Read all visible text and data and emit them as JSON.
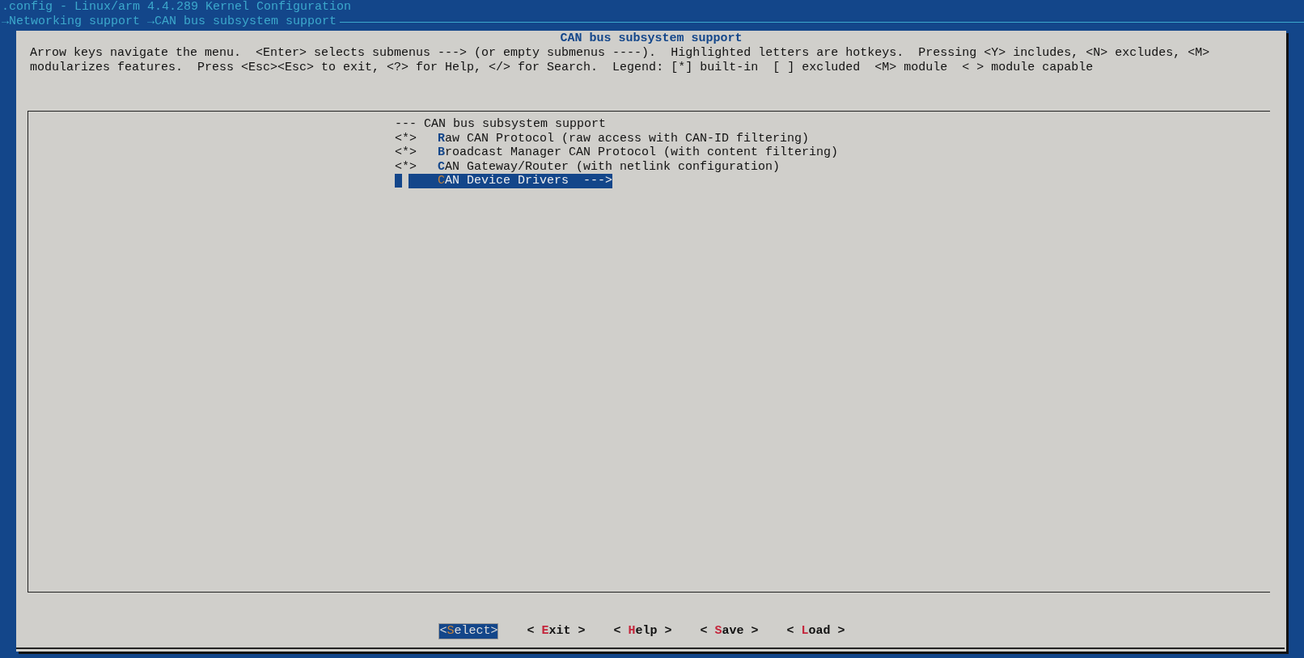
{
  "window": {
    "title": ".config - Linux/arm 4.4.289 Kernel Configuration"
  },
  "breadcrumb": [
    {
      "arrow": "→",
      "label": "Networking support"
    },
    {
      "arrow": "→",
      "label": "CAN bus subsystem support"
    }
  ],
  "dialog": {
    "title": "CAN bus subsystem support",
    "help_lines": [
      "Arrow keys navigate the menu.  <Enter> selects submenus ---> (or empty submenus ----).  Highlighted letters are hotkeys.  Pressing <Y> includes, <N> excludes, <M>",
      "modularizes features.  Press <Esc><Esc> to exit, <?> for Help, </> for Search.  Legend: [*] built-in  [ ] excluded  <M> module  < > module capable"
    ],
    "menu": [
      {
        "kind": "header",
        "text": "--- CAN bus subsystem support"
      },
      {
        "kind": "option",
        "prefix": "<*>",
        "hotkey": "R",
        "rest": "aw CAN Protocol (raw access with CAN-ID filtering)",
        "selected": false
      },
      {
        "kind": "option",
        "prefix": "<*>",
        "hotkey": "B",
        "rest": "roadcast Manager CAN Protocol (with content filtering)",
        "selected": false
      },
      {
        "kind": "option",
        "prefix": "<*>",
        "hotkey": "C",
        "rest": "AN Gateway/Router (with netlink configuration)",
        "selected": false
      },
      {
        "kind": "submenu",
        "hotkey": "C",
        "rest": "AN Device Drivers  --->",
        "selected": true
      }
    ],
    "buttons": [
      {
        "before": "<",
        "hotkey": "S",
        "after": "elect>",
        "selected": true
      },
      {
        "before": "< ",
        "hotkey": "E",
        "after": "xit >",
        "selected": false
      },
      {
        "before": "< ",
        "hotkey": "H",
        "after": "elp >",
        "selected": false
      },
      {
        "before": "< ",
        "hotkey": "S",
        "after": "ave >",
        "selected": false
      },
      {
        "before": "< ",
        "hotkey": "L",
        "after": "oad >",
        "selected": false
      }
    ]
  }
}
